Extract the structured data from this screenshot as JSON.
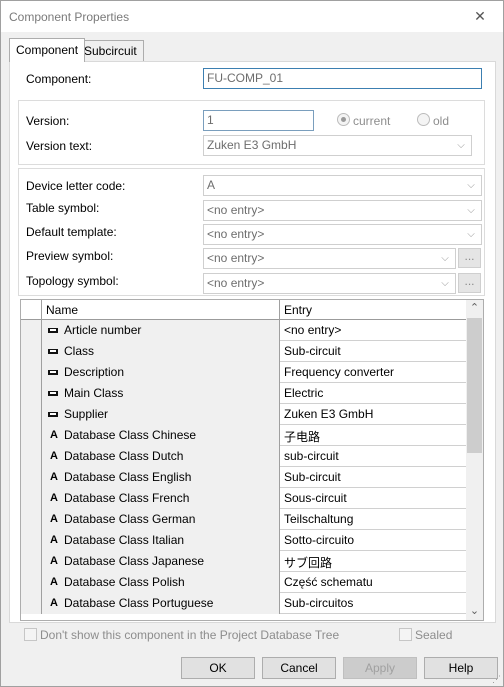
{
  "window": {
    "title": "Component Properties",
    "close_glyph": "✕"
  },
  "tabs": [
    {
      "label": "Component",
      "active": true
    },
    {
      "label": "Subcircuit",
      "active": false
    }
  ],
  "component": {
    "label": "Component:",
    "value": "FU-COMP_01"
  },
  "version": {
    "label": "Version:",
    "value": "1",
    "current_label": "current",
    "old_label": "old",
    "selected": "current",
    "text_label": "Version text:",
    "text_value": "Zuken E3 GmbH"
  },
  "fields": {
    "device_letter": {
      "label": "Device letter code:",
      "value": "A"
    },
    "table_symbol": {
      "label": "Table symbol:",
      "value": "<no entry>"
    },
    "default_template": {
      "label": "Default template:",
      "value": "<no entry>"
    },
    "preview_symbol": {
      "label": "Preview symbol:",
      "value": "<no entry>"
    },
    "topology_symbol": {
      "label": "Topology symbol:",
      "value": "<no entry>"
    }
  },
  "browse_label": "...",
  "dropdown_glyph": "⌵",
  "grid": {
    "columns": [
      "Name",
      "Entry"
    ],
    "rows": [
      {
        "icon": "attribute-icon",
        "name": "Article number",
        "entry": "<no entry>"
      },
      {
        "icon": "attribute-icon",
        "name": "Class",
        "entry": "Sub-circuit"
      },
      {
        "icon": "attribute-icon",
        "name": "Description",
        "entry": "Frequency converter"
      },
      {
        "icon": "attribute-icon",
        "name": "Main Class",
        "entry": "Electric"
      },
      {
        "icon": "attribute-icon",
        "name": "Supplier",
        "entry": "Zuken E3 GmbH"
      },
      {
        "icon": "text-a-icon",
        "glyph": "A",
        "name": "Database Class Chinese",
        "entry": "子电路"
      },
      {
        "icon": "text-a-icon",
        "glyph": "A",
        "name": "Database Class Dutch",
        "entry": "sub-circuit"
      },
      {
        "icon": "text-a-icon",
        "glyph": "A",
        "name": "Database Class English",
        "entry": "Sub-circuit"
      },
      {
        "icon": "text-a-icon",
        "glyph": "A",
        "name": "Database Class French",
        "entry": "Sous-circuit"
      },
      {
        "icon": "text-a-icon",
        "glyph": "A",
        "name": "Database Class German",
        "entry": "Teilschaltung"
      },
      {
        "icon": "text-a-icon",
        "glyph": "A",
        "name": "Database Class Italian",
        "entry": "Sotto-circuito"
      },
      {
        "icon": "text-a-icon",
        "glyph": "A",
        "name": "Database Class Japanese",
        "entry": "サブ回路"
      },
      {
        "icon": "text-a-icon",
        "glyph": "A",
        "name": "Database Class Polish",
        "entry": "Część schematu"
      },
      {
        "icon": "text-a-icon",
        "glyph": "A",
        "name": "Database Class Portuguese",
        "entry": "Sub-circuitos"
      }
    ],
    "scroll_up": "⌃",
    "scroll_down": "⌄"
  },
  "options": {
    "dont_show_label": "Don't show this component in the Project Database Tree",
    "sealed_label": "Sealed"
  },
  "buttons": {
    "ok": "OK",
    "cancel": "Cancel",
    "apply": "Apply",
    "help": "Help"
  },
  "colors": {
    "focus_border": "#3c7fb1",
    "disabled_text": "#a0a0a0"
  }
}
